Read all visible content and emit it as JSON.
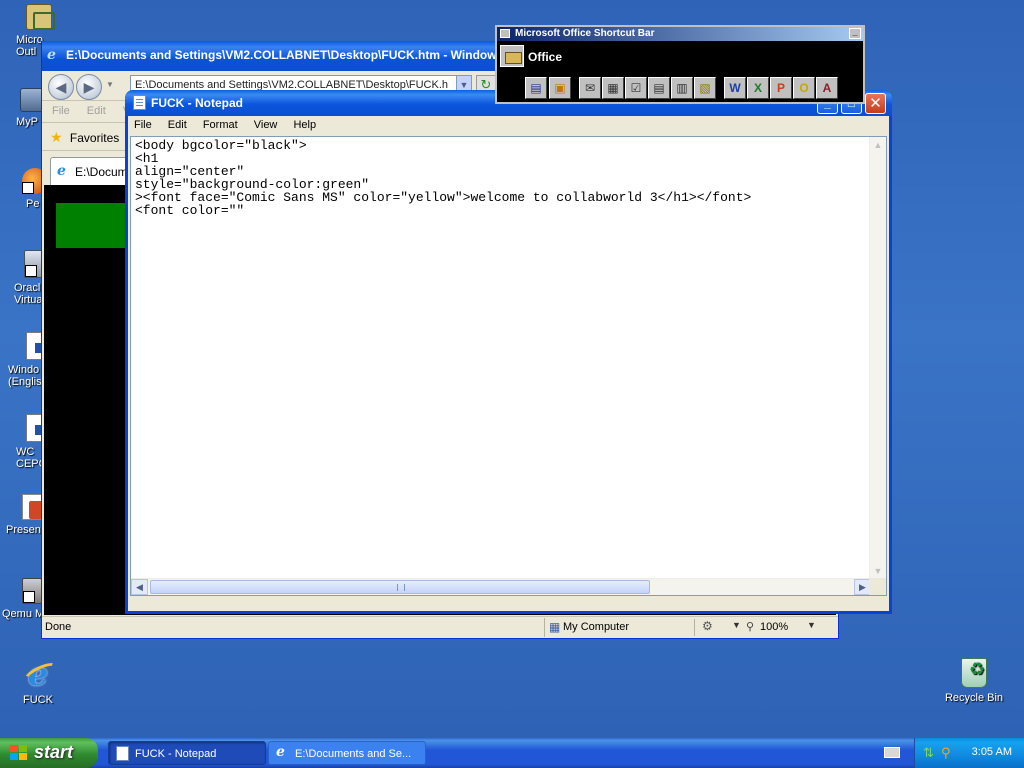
{
  "desktop": {
    "icons": [
      {
        "label": "Micro\nOutl"
      },
      {
        "label": "MyP"
      },
      {
        "label": "Pe"
      },
      {
        "label": "Oracl\nVirtua"
      },
      {
        "label": "Windo\n(Englis"
      },
      {
        "label": "WC\nCEPC"
      },
      {
        "label": "Presen"
      },
      {
        "label": "Qemu M"
      },
      {
        "label": "FUCK"
      },
      {
        "label": "Recycle Bin"
      }
    ]
  },
  "ie_window": {
    "title": "E:\\Documents and Settings\\VM2.COLLABNET\\Desktop\\FUCK.htm - Windows Intern",
    "address": "E:\\Documents and Settings\\VM2.COLLABNET\\Desktop\\FUCK.h",
    "menu": [
      "File",
      "Edit",
      "V"
    ],
    "favorites_label": "Favorites",
    "tab_label": "E:\\Docume",
    "status": {
      "text": "Done",
      "zone": "My Computer",
      "zoom": "100%"
    },
    "content_bg": "#000000",
    "block_color": "#008000"
  },
  "notepad": {
    "title": "FUCK - Notepad",
    "menu": [
      "File",
      "Edit",
      "Format",
      "View",
      "Help"
    ],
    "content": "<body bgcolor=\"black\">\n<h1\nalign=\"center\"\nstyle=\"background-color:green\"\n><font face=\"Comic Sans MS\" color=\"yellow\">welcome to collabworld 3</h1></font>\n<font color=\"\""
  },
  "office_bar": {
    "title": "Microsoft Office Shortcut Bar",
    "folder_label": "Office",
    "tools": [
      {
        "icon": "new-office-doc-icon",
        "glyph": "▤",
        "color": "#1d3c8f"
      },
      {
        "icon": "open-office-doc-icon",
        "glyph": "▣",
        "color": "#c07a00"
      },
      {
        "icon": "new-message-icon",
        "glyph": "✉",
        "color": "#333333"
      },
      {
        "icon": "new-appointment-icon",
        "glyph": "▦",
        "color": "#333333"
      },
      {
        "icon": "new-task-icon",
        "glyph": "☑",
        "color": "#333333"
      },
      {
        "icon": "new-contact-icon",
        "glyph": "▤",
        "color": "#333333"
      },
      {
        "icon": "new-journal-icon",
        "glyph": "▥",
        "color": "#333333"
      },
      {
        "icon": "new-note-icon",
        "glyph": "▧",
        "color": "#8a7a00"
      },
      {
        "icon": "word-icon",
        "glyph": "W",
        "color": "#1f3fa8"
      },
      {
        "icon": "excel-icon",
        "glyph": "X",
        "color": "#1f7a2a"
      },
      {
        "icon": "powerpoint-icon",
        "glyph": "P",
        "color": "#c5431b"
      },
      {
        "icon": "outlook-icon",
        "glyph": "O",
        "color": "#c8a800"
      },
      {
        "icon": "access-icon",
        "glyph": "A",
        "color": "#8a1f2a"
      }
    ]
  },
  "taskbar": {
    "start_label": "start",
    "tasks": [
      {
        "label": "FUCK - Notepad",
        "active": true
      },
      {
        "label": "E:\\Documents and Se...",
        "active": false
      }
    ],
    "clock": "3:05 AM"
  }
}
